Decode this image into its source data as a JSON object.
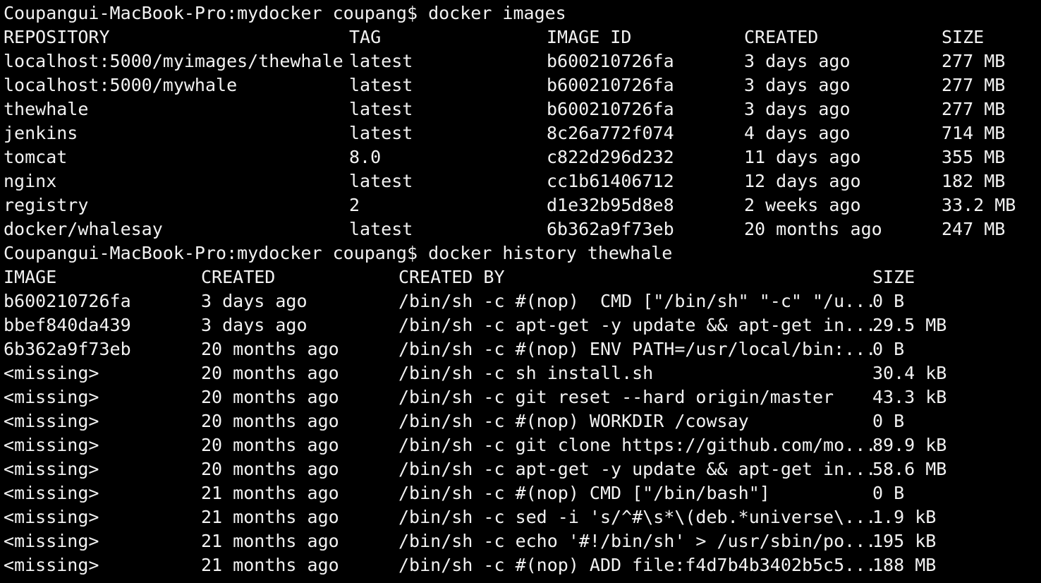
{
  "terminal": {
    "background": "#000000",
    "foreground": "#f2f2f2"
  },
  "command1": {
    "prompt": "Coupangui-MacBook-Pro:mydocker coupang$",
    "command": "docker images"
  },
  "images": {
    "headers": [
      "REPOSITORY",
      "TAG",
      "IMAGE ID",
      "CREATED",
      "SIZE"
    ],
    "rows": [
      [
        "localhost:5000/myimages/thewhale",
        "latest",
        "b600210726fa",
        "3 days ago",
        "277 MB"
      ],
      [
        "localhost:5000/mywhale",
        "latest",
        "b600210726fa",
        "3 days ago",
        "277 MB"
      ],
      [
        "thewhale",
        "latest",
        "b600210726fa",
        "3 days ago",
        "277 MB"
      ],
      [
        "jenkins",
        "latest",
        "8c26a772f074",
        "4 days ago",
        "714 MB"
      ],
      [
        "tomcat",
        "8.0",
        "c822d296d232",
        "11 days ago",
        "355 MB"
      ],
      [
        "nginx",
        "latest",
        "cc1b61406712",
        "12 days ago",
        "182 MB"
      ],
      [
        "registry",
        "2",
        "d1e32b95d8e8",
        "2 weeks ago",
        "33.2 MB"
      ],
      [
        "docker/whalesay",
        "latest",
        "6b362a9f73eb",
        "20 months ago",
        "247 MB"
      ]
    ]
  },
  "command2": {
    "prompt": "Coupangui-MacBook-Pro:mydocker coupang$",
    "command": "docker history thewhale"
  },
  "history": {
    "headers": [
      "IMAGE",
      "CREATED",
      "CREATED BY",
      "SIZE"
    ],
    "rows": [
      [
        "b600210726fa",
        "3 days ago",
        "/bin/sh -c #(nop)  CMD [\"/bin/sh\" \"-c\" \"/u...",
        "0 B"
      ],
      [
        "bbef840da439",
        "3 days ago",
        "/bin/sh -c apt-get -y update && apt-get in...",
        "29.5 MB"
      ],
      [
        "6b362a9f73eb",
        "20 months ago",
        "/bin/sh -c #(nop) ENV PATH=/usr/local/bin:...",
        "0 B"
      ],
      [
        "<missing>",
        "20 months ago",
        "/bin/sh -c sh install.sh",
        "30.4 kB"
      ],
      [
        "<missing>",
        "20 months ago",
        "/bin/sh -c git reset --hard origin/master",
        "43.3 kB"
      ],
      [
        "<missing>",
        "20 months ago",
        "/bin/sh -c #(nop) WORKDIR /cowsay",
        "0 B"
      ],
      [
        "<missing>",
        "20 months ago",
        "/bin/sh -c git clone https://github.com/mo...",
        "89.9 kB"
      ],
      [
        "<missing>",
        "20 months ago",
        "/bin/sh -c apt-get -y update && apt-get in...",
        "58.6 MB"
      ],
      [
        "<missing>",
        "21 months ago",
        "/bin/sh -c #(nop) CMD [\"/bin/bash\"]",
        "0 B"
      ],
      [
        "<missing>",
        "21 months ago",
        "/bin/sh -c sed -i 's/^#\\s*\\(deb.*universe\\...",
        "1.9 kB"
      ],
      [
        "<missing>",
        "21 months ago",
        "/bin/sh -c echo '#!/bin/sh' > /usr/sbin/po...",
        "195 kB"
      ],
      [
        "<missing>",
        "21 months ago",
        "/bin/sh -c #(nop) ADD file:f4d7b4b3402b5c5...",
        "188 MB"
      ]
    ]
  }
}
